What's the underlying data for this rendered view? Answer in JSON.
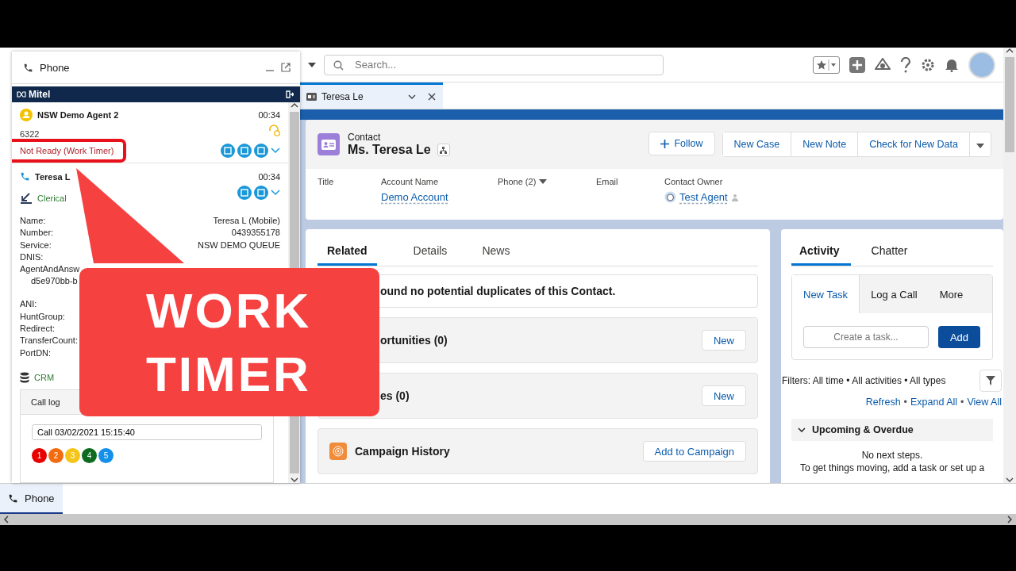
{
  "phone_panel": {
    "title": "Phone",
    "brand": "Mitel",
    "agent": {
      "name": "NSW Demo Agent 2",
      "timer": "00:34",
      "extension": "6322",
      "status": "Not Ready (Work Timer)"
    },
    "call": {
      "caller": "Teresa L",
      "timer": "00:34",
      "category": "Clerical",
      "details": [
        {
          "label": "Name:",
          "value": "Teresa L (Mobile)"
        },
        {
          "label": "Number:",
          "value": "0439355178"
        },
        {
          "label": "Service:",
          "value": "NSW DEMO QUEUE"
        },
        {
          "label": "DNIS:"
        },
        {
          "label": "AgentAndAnsw",
          "continuation": "d5e970bb-b"
        },
        {
          "label": "ANI:"
        },
        {
          "label": "HuntGroup:"
        },
        {
          "label": "Redirect:"
        },
        {
          "label": "TransferCount:"
        },
        {
          "label": "PortDN:"
        }
      ],
      "crm": "CRM"
    },
    "call_log": {
      "title": "Call log",
      "value": "Call 03/02/2021 15:15:40",
      "ratings": [
        {
          "label": "1",
          "color": "#e60000"
        },
        {
          "label": "2",
          "color": "#f26b0f"
        },
        {
          "label": "3",
          "color": "#f5c518"
        },
        {
          "label": "4",
          "color": "#0f6b1f"
        },
        {
          "label": "5",
          "color": "#1590e8"
        }
      ]
    }
  },
  "header": {
    "search_placeholder": "Search..."
  },
  "tabs": [
    {
      "label": "Teresa Le",
      "selected": true
    }
  ],
  "record": {
    "object": "Contact",
    "name": "Ms. Teresa Le",
    "actions": [
      {
        "label": "Follow",
        "kind": "follow"
      },
      {
        "label": "New Case",
        "kind": "plain"
      },
      {
        "label": "New Note",
        "kind": "plain"
      },
      {
        "label": "Check for New Data",
        "kind": "plain"
      }
    ],
    "fields": [
      {
        "label": "Title"
      },
      {
        "label": "Account Name",
        "value": "Demo Account"
      },
      {
        "label": "Phone (2)",
        "kind": "dropdown"
      },
      {
        "label": "Email"
      },
      {
        "label": "Contact Owner",
        "value": "Test Agent",
        "kind": "user"
      }
    ]
  },
  "related": {
    "tabs": [
      {
        "label": "Related",
        "selected": true
      },
      {
        "label": "Details",
        "selected": false
      },
      {
        "label": "News",
        "selected": false
      }
    ],
    "duplicates": "ound no potential duplicates of this Contact.",
    "lists": [
      {
        "title": "ortunities (0)",
        "action": "New",
        "kind": "plain"
      },
      {
        "title": "es (0)",
        "action": "New",
        "kind": "plain"
      },
      {
        "title": "Campaign History",
        "action": "Add to Campaign",
        "kind": "campaign"
      }
    ]
  },
  "activity": {
    "tabs": [
      {
        "label": "Activity",
        "selected": true
      },
      {
        "label": "Chatter",
        "selected": false
      }
    ],
    "composer_tabs": [
      {
        "label": "New Task",
        "selected": true
      },
      {
        "label": "Log a Call",
        "selected": false
      },
      {
        "label": "More",
        "selected": false
      }
    ],
    "task_placeholder": "Create a task...",
    "add": "Add",
    "filters": "Filters: All time • All activities • All types",
    "links": [
      "Refresh",
      "Expand All",
      "View All"
    ],
    "separator": "•",
    "section": "Upcoming & Overdue",
    "empty_title": "No next steps.",
    "empty_text": "To get things moving, add a task or set up a"
  },
  "utility_bar": [
    {
      "label": "Phone",
      "selected": true
    }
  ],
  "callout": {
    "lines": [
      "WORK",
      "TIMER"
    ]
  }
}
